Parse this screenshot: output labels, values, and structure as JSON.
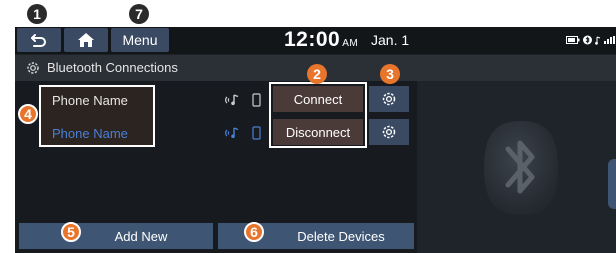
{
  "topbar": {
    "menu_label": "Menu",
    "time": "12:00",
    "ampm": "AM",
    "date": "Jan. 1"
  },
  "title": "Bluetooth Connections",
  "devices": [
    {
      "name": "Phone Name",
      "action": "Connect",
      "name_color": "#e6e6e6"
    },
    {
      "name": "Phone Name",
      "action": "Disconnect",
      "name_color": "#4a7fd6"
    }
  ],
  "bottom": {
    "add_new": "Add New",
    "delete_devices": "Delete Devices"
  },
  "callouts": [
    "1",
    "2",
    "3",
    "4",
    "5",
    "6",
    "7"
  ],
  "colors": {
    "callout": "#e8752c",
    "accent_blue": "#4a7fd6",
    "button_blue": "#3e5573"
  }
}
